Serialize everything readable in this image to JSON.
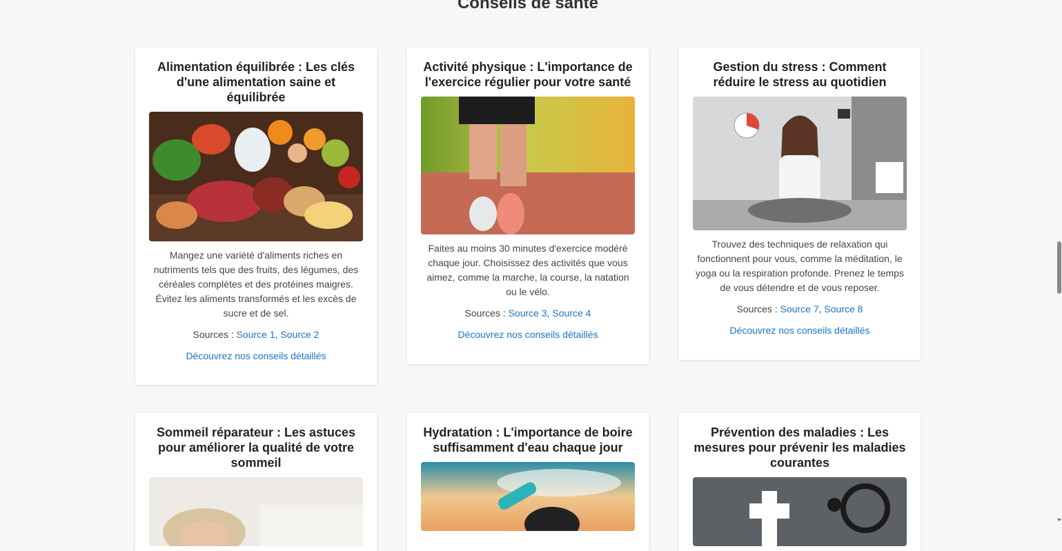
{
  "page": {
    "title": "Conseils de santé"
  },
  "cards": [
    {
      "title": "Alimentation équilibrée : Les clés d'une alimentation saine et équilibrée",
      "image_subject": "healthy-food-spread",
      "description": "Mangez une variété d'aliments riches en nutriments tels que des fruits, des légumes, des céréales complètes et des protéines maigres. Évitez les aliments transformés et les excès de sucre et de sel.",
      "sources_label": "Sources :",
      "sources": [
        "Source 1",
        "Source 2"
      ],
      "more_link": "Découvrez nos conseils détaillés"
    },
    {
      "title": "Activité physique : L'importance de l'exercice régulier pour votre santé",
      "image_subject": "running-legs",
      "description": "Faites au moins 30 minutes d'exercice modéré chaque jour. Choisissez des activités que vous aimez, comme la marche, la course, la natation ou le vélo.",
      "sources_label": "Sources :",
      "sources": [
        "Source 3",
        "Source 4"
      ],
      "more_link": "Découvrez nos conseils détaillés"
    },
    {
      "title": "Gestion du stress : Comment réduire le stress au quotidien",
      "image_subject": "meditating-woman-office",
      "description": "Trouvez des techniques de relaxation qui fonctionnent pour vous, comme la méditation, le yoga ou la respiration profonde. Prenez le temps de vous détendre et de vous reposer.",
      "sources_label": "Sources :",
      "sources": [
        "Source 7",
        "Source 8"
      ],
      "more_link": "Découvrez nos conseils détaillés"
    },
    {
      "title": "Sommeil réparateur : Les astuces pour améliorer la qualité de votre sommeil",
      "image_subject": "sleeping-person"
    },
    {
      "title": "Hydratation : L'importance de boire suffisamment d'eau chaque jour",
      "image_subject": "drinking-water-sky"
    },
    {
      "title": "Prévention des maladies : Les mesures pour prévenir les maladies courantes",
      "image_subject": "medical-cross-stethoscope"
    }
  ],
  "colors": {
    "link": "#1a73c8",
    "background": "#f7f7f7",
    "card": "#ffffff"
  }
}
